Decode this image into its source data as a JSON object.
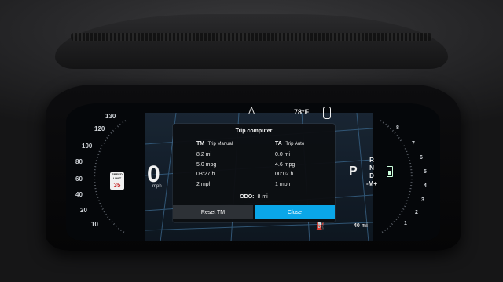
{
  "colors": {
    "accent": "#0aa6e8",
    "fuel_warning": "#f9a825"
  },
  "status": {
    "temperature": "78°F",
    "road_icon": "road-icon",
    "car_icon": "car-icon"
  },
  "speedometer": {
    "ticks": [
      "130",
      "120",
      "100",
      "80",
      "60",
      "40",
      "20",
      "10"
    ],
    "speed": "0",
    "unit": "mph",
    "limit_sign_text": "SPEED LIMIT",
    "limit_value": "35"
  },
  "rpm_gauge": {
    "ticks": [
      "8",
      "7",
      "6",
      "5",
      "4",
      "3",
      "2",
      "1"
    ]
  },
  "gear": {
    "current": "P",
    "list": [
      "R",
      "N",
      "D",
      "-M+"
    ]
  },
  "trip_computer": {
    "title": "Trip computer",
    "left": {
      "code": "TM",
      "label": "Trip Manual",
      "rows": [
        "8.2 mi",
        "5.0 mpg",
        "03:27 h",
        "2 mph"
      ]
    },
    "right": {
      "code": "TA",
      "label": "Trip Auto",
      "rows": [
        "0.0 mi",
        "4.6 mpg",
        "00:02 h",
        "1 mph"
      ]
    },
    "odo_label": "ODO:",
    "odo_value": "8 mi",
    "reset_label": "Reset TM",
    "close_label": "Close"
  },
  "fuel": {
    "range": "40 mi"
  }
}
